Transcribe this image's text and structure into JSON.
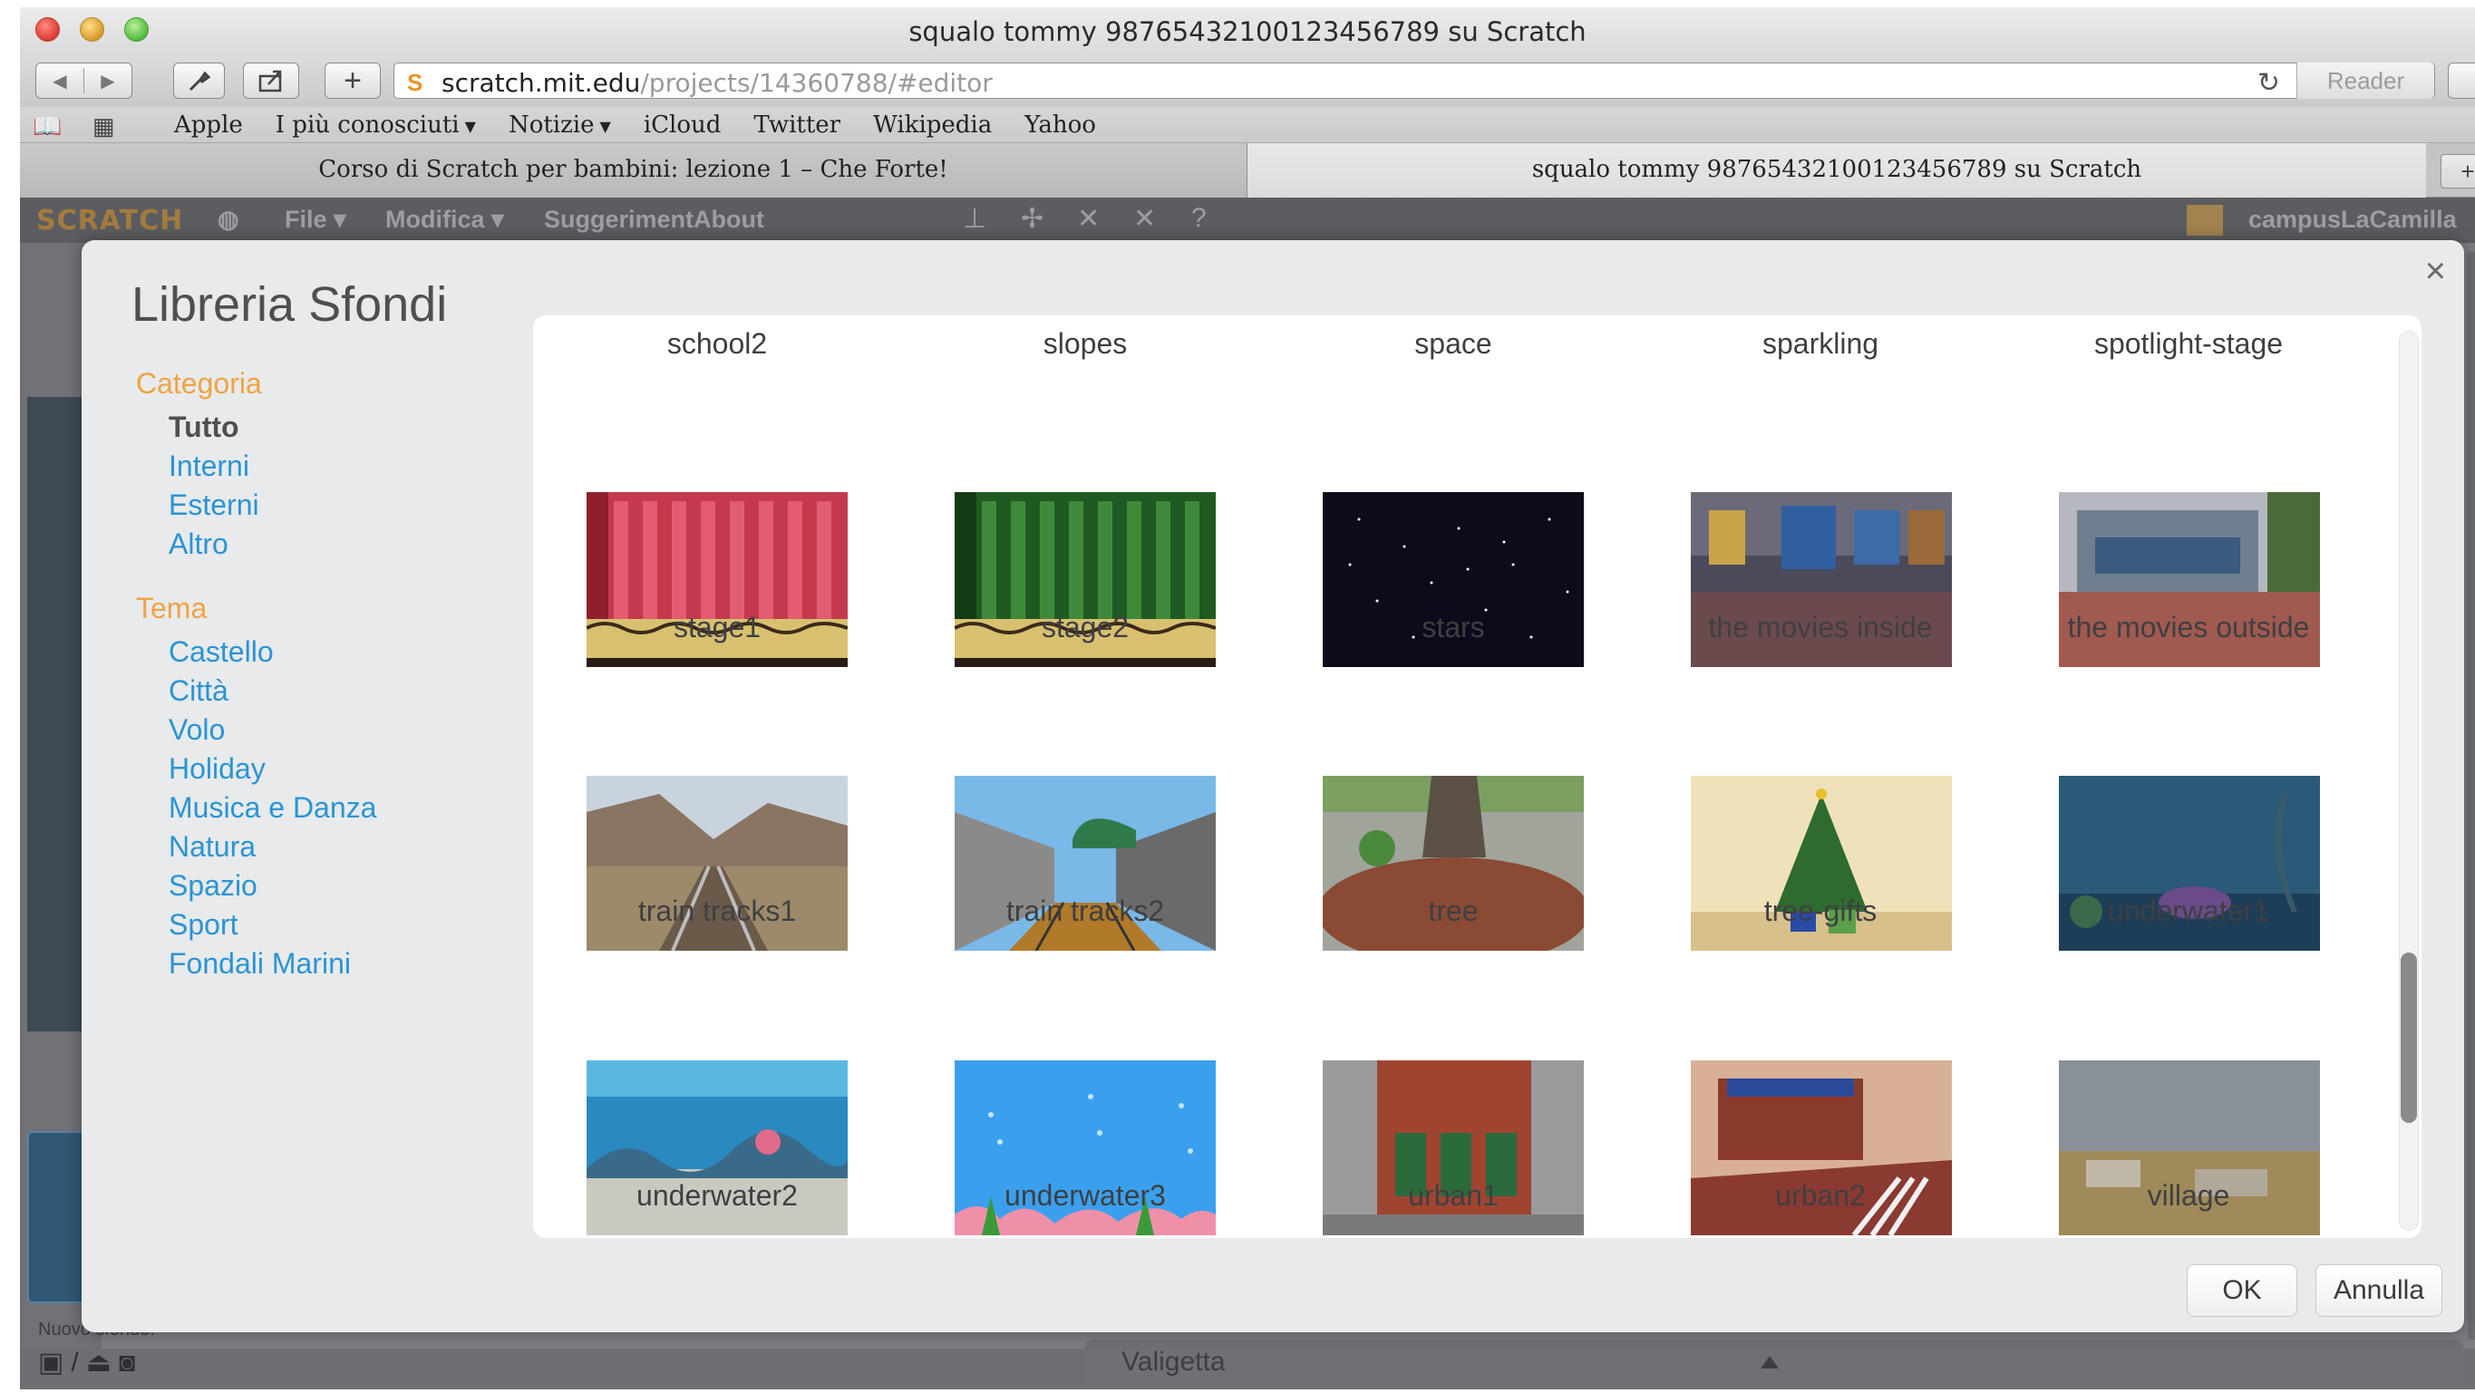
{
  "window": {
    "title": "squalo tommy 98765432100123456789 su Scratch"
  },
  "toolbar": {
    "url_domain": "scratch.mit.edu",
    "url_path": "/projects/14360788/#editor",
    "reader_label": "Reader"
  },
  "bookmarks": {
    "items": [
      "Apple",
      "I più conosciuti",
      "Notizie",
      "iCloud",
      "Twitter",
      "Wikipedia",
      "Yahoo"
    ]
  },
  "tabs": [
    "Corso di Scratch per bambini: lezione 1 – Che Forte!",
    "squalo tommy 98765432100123456789 su Scratch"
  ],
  "scratch": {
    "logo": "SCRATCH",
    "menus": [
      "File ▾",
      "Modifica ▾",
      "SuggerimentAbout"
    ],
    "user": "campusLaCamilla",
    "backpack": "Valigetta",
    "new_backdrop": "Nuovo sfondo:"
  },
  "dialog": {
    "title": "Libreria Sfondi",
    "category_heading": "Categoria",
    "categories": [
      "Tutto",
      "Interni",
      "Esterni",
      "Altro"
    ],
    "selected_category": "Tutto",
    "theme_heading": "Tema",
    "themes": [
      "Castello",
      "Città",
      "Volo",
      "Holiday",
      "Musica e Danza",
      "Natura",
      "Spazio",
      "Sport",
      "Fondali Marini"
    ],
    "top_labels": [
      "school2",
      "slopes",
      "space",
      "sparkling",
      "spotlight-stage"
    ],
    "rows": [
      [
        "stage1",
        "stage2",
        "stars",
        "the movies inside",
        "the movies outside"
      ],
      [
        "train tracks1",
        "train tracks2",
        "tree",
        "tree-gifts",
        "underwater1"
      ],
      [
        "underwater2",
        "underwater3",
        "urban1",
        "urban2",
        "village"
      ]
    ],
    "ok_label": "OK",
    "cancel_label": "Annulla"
  },
  "colors": {
    "category_heading": "#f0a342",
    "link": "#2a94d4",
    "title": "#4f4f52"
  }
}
